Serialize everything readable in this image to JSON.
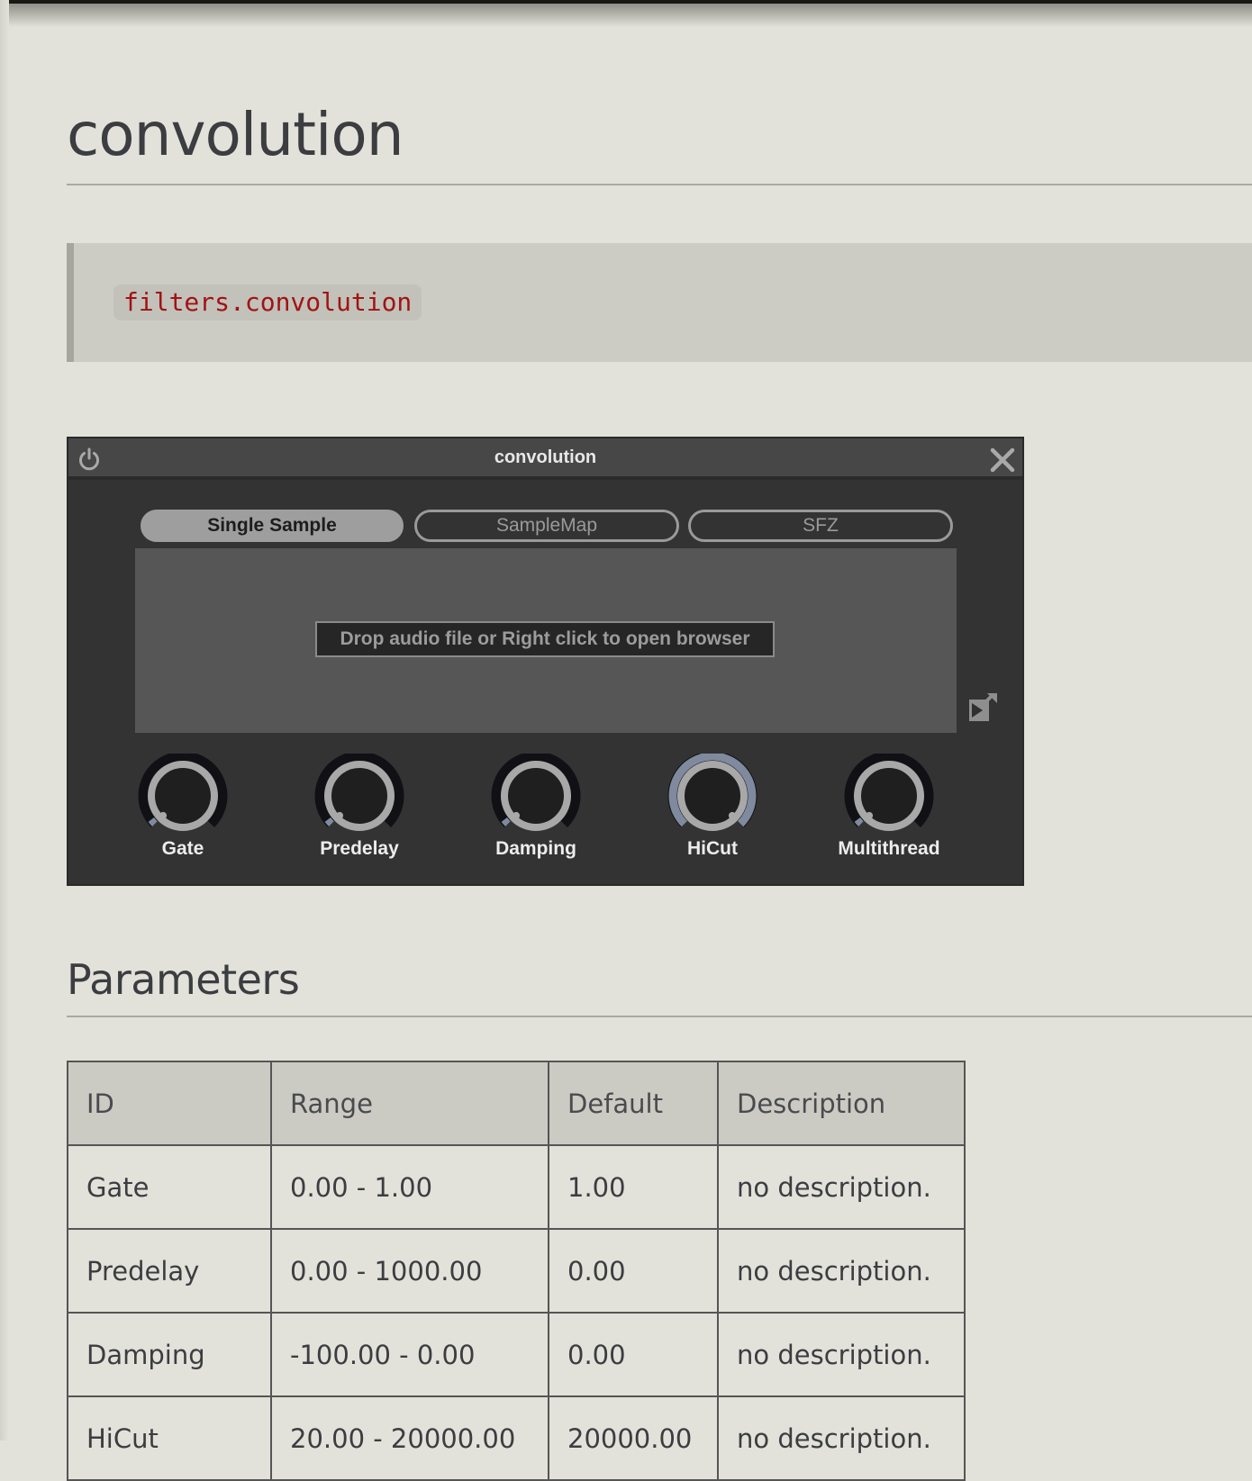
{
  "page": {
    "title": "convolution",
    "module_path": "filters.convolution"
  },
  "plugin": {
    "title": "convolution",
    "power_icon": "power-icon",
    "close_icon": "close-icon",
    "tabs": [
      {
        "label": "Single Sample",
        "active": true
      },
      {
        "label": "SampleMap",
        "active": false
      },
      {
        "label": "SFZ",
        "active": false
      }
    ],
    "drop_hint": "Drop audio file or Right click to open browser",
    "export_icon": "export-icon",
    "knobs": [
      {
        "label": "Gate",
        "value": 0.0,
        "highlight": false
      },
      {
        "label": "Predelay",
        "value": 0.0,
        "highlight": false
      },
      {
        "label": "Damping",
        "value": 0.0,
        "highlight": false
      },
      {
        "label": "HiCut",
        "value": 1.0,
        "highlight": true
      },
      {
        "label": "Multithread",
        "value": 0.0,
        "highlight": false
      }
    ],
    "colors": {
      "arc_active": "#7f8a9f",
      "arc_track": "#111115",
      "knob_ring": "#a8a8a8"
    }
  },
  "parameters": {
    "heading": "Parameters",
    "columns": [
      "ID",
      "Range",
      "Default",
      "Description"
    ],
    "rows": [
      [
        "Gate",
        "0.00 - 1.00",
        "1.00",
        "no description."
      ],
      [
        "Predelay",
        "0.00 - 1000.00",
        "0.00",
        "no description."
      ],
      [
        "Damping",
        "-100.00 - 0.00",
        "0.00",
        "no description."
      ],
      [
        "HiCut",
        "20.00 - 20000.00",
        "20000.00",
        "no description."
      ]
    ]
  }
}
